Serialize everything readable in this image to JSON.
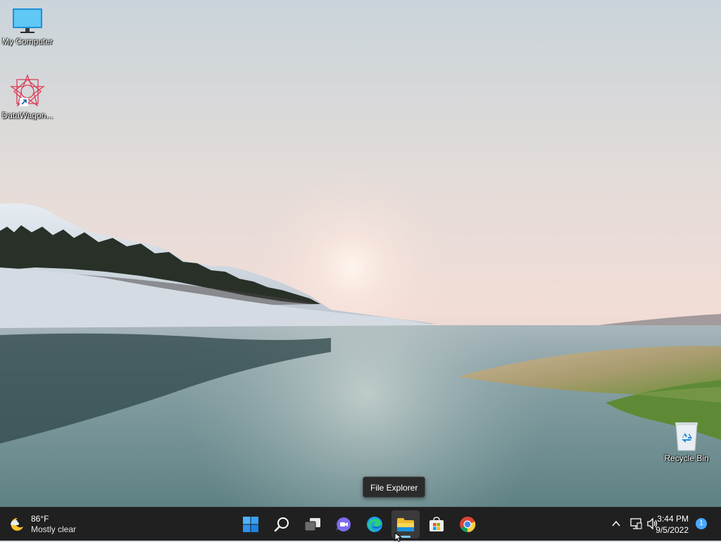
{
  "desktop": {
    "icons": [
      {
        "label": "My Computer"
      },
      {
        "label": "DataWagon..."
      },
      {
        "label": "Recycle Bin"
      }
    ]
  },
  "tooltip": {
    "text": "File Explorer"
  },
  "taskbar": {
    "weather": {
      "temp": "86°F",
      "condition": "Mostly clear",
      "icon": "moon-cloud-icon"
    },
    "apps": [
      {
        "name": "start",
        "icon": "windows-logo-icon"
      },
      {
        "name": "search",
        "icon": "search-icon"
      },
      {
        "name": "task-view",
        "icon": "task-view-icon"
      },
      {
        "name": "chat",
        "icon": "teams-chat-icon"
      },
      {
        "name": "edge",
        "icon": "edge-icon"
      },
      {
        "name": "file-explorer",
        "icon": "folder-icon",
        "active": true
      },
      {
        "name": "store",
        "icon": "store-icon"
      },
      {
        "name": "chrome",
        "icon": "chrome-icon"
      }
    ],
    "tray": {
      "time": "3:44 PM",
      "date": "9/5/2022",
      "notification_count": "1"
    }
  },
  "colors": {
    "taskbar_bg": "#202020",
    "accent": "#4aa8ff"
  }
}
